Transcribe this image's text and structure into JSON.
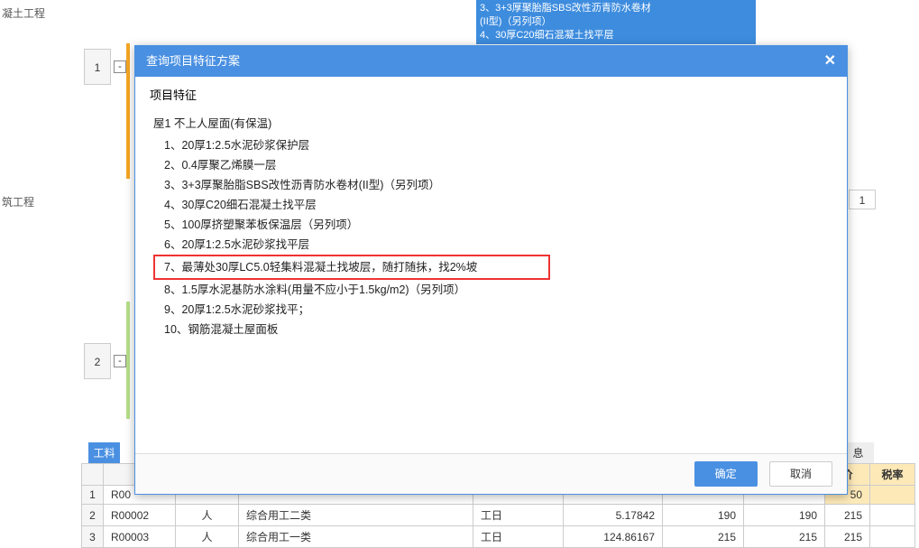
{
  "sidebar": {
    "item1": "凝土工程",
    "item2": "筑工程"
  },
  "bg_numbers": {
    "n1": "1",
    "n2": "2",
    "expand": "-"
  },
  "bg_highlight": {
    "l1": "3、3+3厚聚胎脂SBS改性沥青防水卷材",
    "l2": "(II型)（另列项）",
    "l3": "4、30厚C20细石混凝土找平层"
  },
  "right_cell": "1",
  "dialog": {
    "title": "查询项目特征方案",
    "subtitle": "项目特征",
    "header": "屋1  不上人屋面(有保温)",
    "items": [
      "1、20厚1:2.5水泥砂浆保护层",
      "2、0.4厚聚乙烯膜一层",
      "3、3+3厚聚胎脂SBS改性沥青防水卷材(II型)（另列项）",
      "4、30厚C20细石混凝土找平层",
      "5、100厚挤塑聚苯板保温层（另列项）",
      "6、20厚1:2.5水泥砂浆找平层",
      "7、最薄处30厚LC5.0轻集料混凝土找坡层，随打随抹，找2%坡",
      "8、1.5厚水泥基防水涂料(用量不应小于1.5kg/m2)（另列项）",
      "9、20厚1:2.5水泥砂浆找平；",
      "10、钢筋混凝土屋面板"
    ],
    "ok": "确定",
    "cancel": "取消"
  },
  "tabs": {
    "t1": "工料",
    "t2": "息"
  },
  "lower": {
    "headers": {
      "price": "价",
      "rate": "税率"
    },
    "rows": [
      {
        "n": "1",
        "code": "R00",
        "unit": "",
        "name": "",
        "u2": "",
        "q": "",
        "p1": "",
        "p2": "",
        "p3": "50"
      },
      {
        "n": "2",
        "code": "R00002",
        "unit": "人",
        "name": "综合用工二类",
        "u2": "工日",
        "q": "5.17842",
        "p1": "190",
        "p2": "190",
        "p3": "215"
      },
      {
        "n": "3",
        "code": "R00003",
        "unit": "人",
        "name": "综合用工一类",
        "u2": "工日",
        "q": "124.86167",
        "p1": "215",
        "p2": "215",
        "p3": "215"
      }
    ]
  }
}
